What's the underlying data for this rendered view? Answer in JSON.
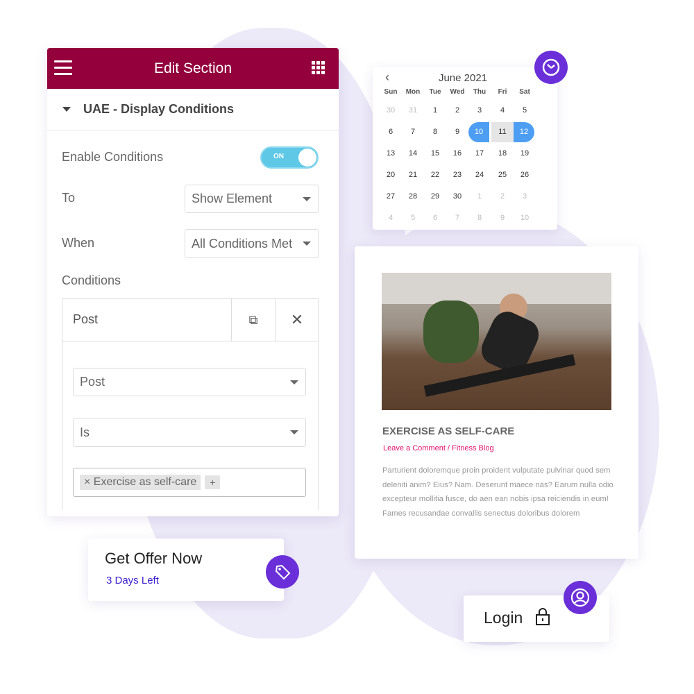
{
  "colors": {
    "header": "#93003c",
    "accent": "#6a2fd8",
    "toggle": "#5ec8e6",
    "selected": "#4d9ef2",
    "link": "#e0116f"
  },
  "panel": {
    "title": "Edit Section",
    "section": "UAE - Display Conditions",
    "enable_label": "Enable Conditions",
    "toggle_text": "ON",
    "toggle_on": true,
    "to_label": "To",
    "to_value": "Show Element",
    "when_label": "When",
    "when_value": "All Conditions Met",
    "conditions_label": "Conditions",
    "cond_title": "Post",
    "cond_type": "Post",
    "cond_operator": "Is",
    "tag": "Exercise as self-care",
    "add": "+"
  },
  "calendar": {
    "month": "June 2021",
    "days": [
      "Sun",
      "Mon",
      "Tue",
      "Wed",
      "Thu",
      "Fri",
      "Sat"
    ],
    "weeks": [
      [
        "30",
        "31",
        "1",
        "2",
        "3",
        "4",
        "5"
      ],
      [
        "6",
        "7",
        "8",
        "9",
        "10",
        "11",
        "12"
      ],
      [
        "13",
        "14",
        "15",
        "16",
        "17",
        "18",
        "19"
      ],
      [
        "20",
        "21",
        "22",
        "23",
        "24",
        "25",
        "26"
      ],
      [
        "27",
        "28",
        "29",
        "30",
        "1",
        "2",
        "3"
      ],
      [
        "4",
        "5",
        "6",
        "7",
        "8",
        "9",
        "10"
      ]
    ],
    "range_start": "10",
    "range_mid": "11",
    "range_end": "12"
  },
  "blog": {
    "title": "EXERCISE AS SELF-CARE",
    "meta": "Leave a Comment / Fitness Blog",
    "body": "Parturient doloremque proin proident vulputate pulvinar quod sem deleniti anim? Eius? Nam. Deserunt maece nas? Earum nulla odio excepteur mollitia fusce, do aen ean nobis ipsa reiciendis in eum! Fames recusandae convallis senectus doloribus dolorem"
  },
  "offer": {
    "title": "Get Offer Now",
    "sub": "3 Days Left"
  },
  "login": {
    "label": "Login"
  }
}
